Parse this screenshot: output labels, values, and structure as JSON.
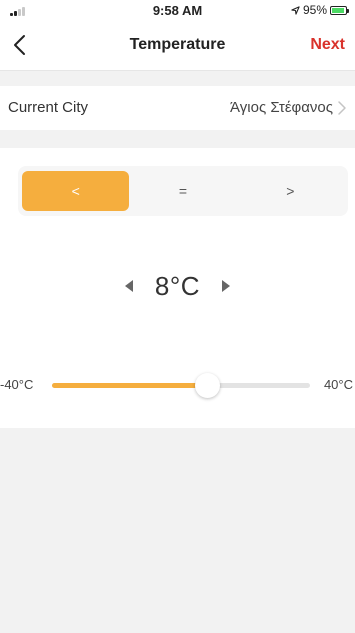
{
  "status_bar": {
    "time": "9:58 AM",
    "battery_percent": "95%",
    "location_icon": "location-arrow-icon",
    "battery_icon": "battery-charging-icon"
  },
  "nav": {
    "title": "Temperature",
    "back_icon": "chevron-left-icon",
    "next_label": "Next"
  },
  "city": {
    "label": "Current City",
    "value": "Άγιος Στέφανος"
  },
  "comparison": {
    "options": [
      "<",
      "=",
      ">"
    ],
    "selected": "<"
  },
  "temperature": {
    "value": "8°C",
    "value_number": 8
  },
  "slider": {
    "min_label": "-40°C",
    "max_label": "40°C",
    "min": -40,
    "max": 40,
    "value": 8
  },
  "colors": {
    "accent": "#f5ae3e",
    "next": "#d9322b",
    "background": "#f2f2f2"
  }
}
